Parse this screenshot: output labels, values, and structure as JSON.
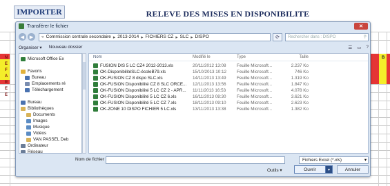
{
  "sheet": {
    "importer_label": "IMPORTER",
    "title": "RELEVE DES MISES EN DISPONIBILITE",
    "side_letters": "N\nE\nF\nA\nR\nE\nE",
    "right_letter": "B",
    "colors": {
      "red_band": "#e53535",
      "yellow_cell": "#f4ee2a",
      "title": "#1c2c5c"
    }
  },
  "dialog": {
    "title": "Transférer le fichier",
    "close_label": "✕",
    "address": {
      "crumbs": [
        "Commission centrale secondaire",
        "2013-2014",
        "FICHIERS CZ",
        "SLC",
        "DISPO"
      ],
      "search_placeholder": "Rechercher dans : DISPO"
    },
    "toolbar": {
      "organize": "Organiser ▾",
      "new_folder": "Nouveau dossier"
    },
    "nav": [
      {
        "label": "Microsoft Office Ex",
        "icon": "excel-icon",
        "color": "#2f7d3a"
      },
      {
        "label": "",
        "icon": "",
        "color": ""
      },
      {
        "label": "Favoris",
        "icon": "star-icon",
        "color": "#e2b23b"
      },
      {
        "label": "Bureau",
        "icon": "desktop-icon",
        "color": "#4a72b0"
      },
      {
        "label": "Emplacements ré",
        "icon": "recent-places-icon",
        "color": "#7a8db0"
      },
      {
        "label": "Téléchargement",
        "icon": "download-icon",
        "color": "#4a72b0"
      },
      {
        "label": "",
        "icon": "",
        "color": ""
      },
      {
        "label": "Bureau",
        "icon": "desktop-icon",
        "color": "#4a72b0"
      },
      {
        "label": "Bibliothèques",
        "icon": "library-icon",
        "color": "#d8b358"
      },
      {
        "label": "Documents",
        "icon": "documents-icon",
        "color": "#d8b358"
      },
      {
        "label": "Images",
        "icon": "images-icon",
        "color": "#5b8cc4"
      },
      {
        "label": "Musique",
        "icon": "music-icon",
        "color": "#5b8cc4"
      },
      {
        "label": "Vidéos",
        "icon": "video-icon",
        "color": "#5b8cc4"
      },
      {
        "label": "VAN PASSEL Deb",
        "icon": "user-folder-icon",
        "color": "#d8b358"
      },
      {
        "label": "Ordinateur",
        "icon": "computer-icon",
        "color": "#6a7d98"
      },
      {
        "label": "Réseau",
        "icon": "network-icon",
        "color": "#6a7d98"
      },
      {
        "label": "Panneau de conf ▾",
        "icon": "control-panel-icon",
        "color": "#6a7d98"
      }
    ],
    "columns": {
      "name": "Nom",
      "date": "Modifié le",
      "type": "Type",
      "size": "Taille"
    },
    "files": [
      {
        "name": "FUSION DIS 5 LC CZ4 2012-2013.xls",
        "date": "20/11/2012 13:08",
        "type": "Feuille Microsoft...",
        "size": "2.237 Ko"
      },
      {
        "name": "OK-DisponibilitéSLC-écoleB79.xls",
        "date": "15/10/2013 10:12",
        "type": "Feuille Microsoft...",
        "size": "746 Ko"
      },
      {
        "name": "OK-FUSION CZ 8 dispo SLC.xls",
        "date": "14/11/2013 13:49",
        "type": "Feuille Microsoft...",
        "size": "1.319 Ko"
      },
      {
        "name": "OK-FUSION Disponibilité CZ 8 SLC ORCE...",
        "date": "12/11/2013 13:56",
        "type": "Feuille Microsoft...",
        "size": "1.847 Ko"
      },
      {
        "name": "OK-FUSION Disponibilité 5 LC CZ 2 - APR...",
        "date": "11/11/2013 16:53",
        "type": "Feuille Microsoft...",
        "size": "4.078 Ko"
      },
      {
        "name": "OK-FUSION Disponibilité 5 LC CZ 6.xls",
        "date": "16/11/2013 08:30",
        "type": "Feuille Microsoft...",
        "size": "3.621 Ko"
      },
      {
        "name": "OK-FUSION Disponibilité 5 LC CZ 7.xls",
        "date": "18/11/2013 09:10",
        "type": "Feuille Microsoft...",
        "size": "2.623 Ko"
      },
      {
        "name": "OK-ZONE 10 DISPO FICHIER 5 LC.xls",
        "date": "13/11/2013 13:38",
        "type": "Feuille Microsoft...",
        "size": "1.382 Ko"
      }
    ],
    "footer": {
      "filename_label": "Nom de fichier :",
      "filename_value": "",
      "filetype": "Fichiers Excel (*.xls)",
      "tools": "Outils ▾",
      "open": "Ouvrir",
      "cancel": "Annuler"
    }
  }
}
